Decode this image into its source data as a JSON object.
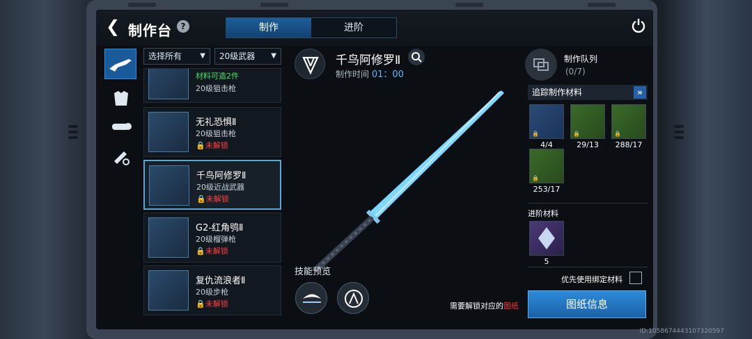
{
  "header": {
    "title": "制作台",
    "help": "?"
  },
  "tabs": [
    {
      "label": "制作"
    },
    {
      "label": "进阶"
    }
  ],
  "filters": {
    "type": "选择所有",
    "level": "20级武器"
  },
  "items": [
    {
      "status": "材料可造2件",
      "type": "20级狙击枪"
    },
    {
      "name": "无礼恐惧Ⅱ",
      "type": "20级狙击枪",
      "lock": "未解锁"
    },
    {
      "name": "千鸟阿修罗Ⅱ",
      "type": "20级近战武器",
      "lock": "未解锁"
    },
    {
      "name": "G2-红角鸮Ⅱ",
      "type": "20级榴弹枪",
      "lock": "未解锁"
    },
    {
      "name": "复仇流浪者Ⅱ",
      "type": "20级步枪",
      "lock": "未解锁"
    }
  ],
  "weapon": {
    "name": "千鸟阿修罗Ⅱ",
    "time_label": "制作时间",
    "time": "01：00"
  },
  "skills": {
    "title": "技能预览"
  },
  "queue": {
    "label": "制作队列",
    "count": "(0/7)"
  },
  "materials": {
    "track_label": "追踪制作材料",
    "items": [
      {
        "count": "4/4"
      },
      {
        "count": "29/13"
      },
      {
        "count": "288/17"
      },
      {
        "count": "253/17"
      }
    ],
    "advanced_label": "进阶材料",
    "advanced_count": "5",
    "prefer_label": "优先使用绑定材料"
  },
  "unlock_prefix": "需要解锁对应的",
  "unlock_highlight": "图纸",
  "blueprint_button": "图纸信息",
  "footer_id": "ID:1058674443107320597"
}
